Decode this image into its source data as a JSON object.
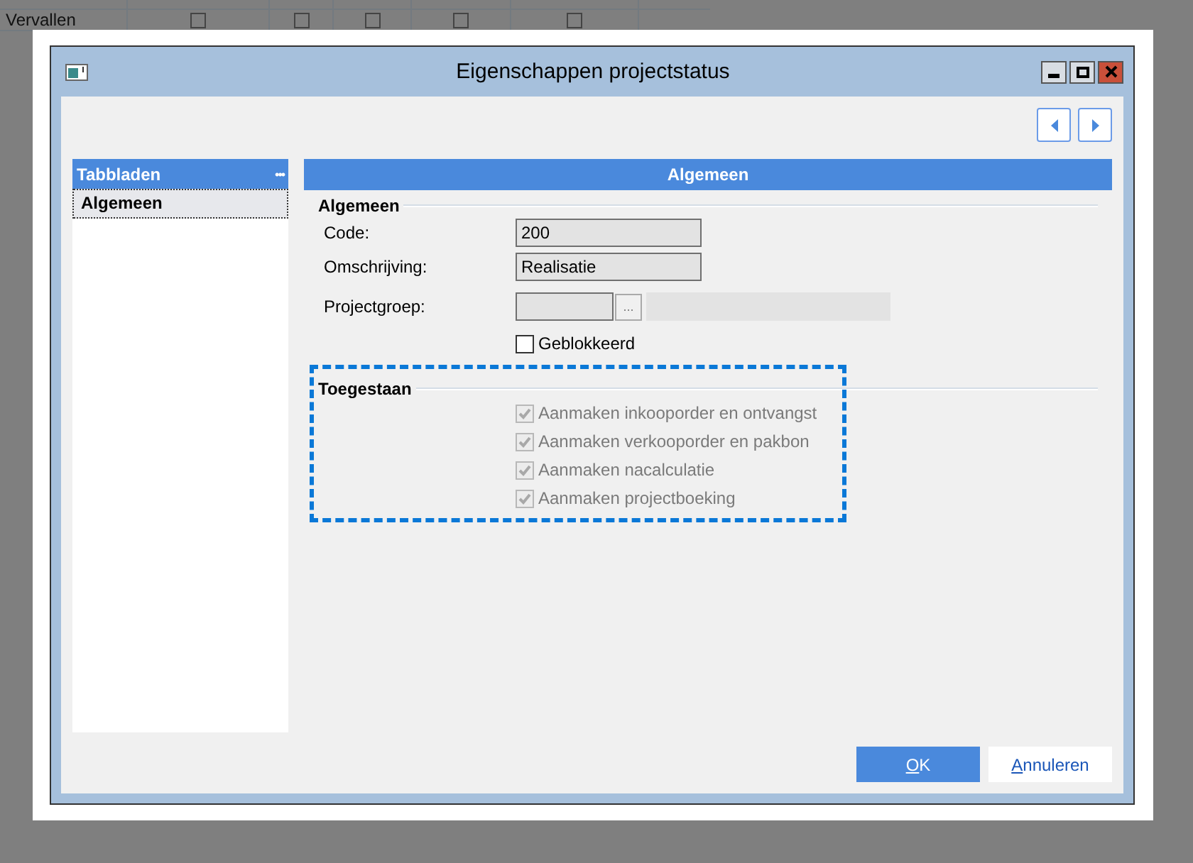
{
  "background_table": {
    "rows": [
      {
        "label": "Vervallen",
        "checks": [
          false,
          false,
          false,
          false,
          false
        ]
      }
    ]
  },
  "window": {
    "title": "Eigenschappen projectstatus"
  },
  "sidebar": {
    "title": "Tabbladen",
    "menu": "•••",
    "items": [
      {
        "label": "Algemeen",
        "selected": true
      }
    ]
  },
  "panel": {
    "title": "Algemeen",
    "general": {
      "legend": "Algemeen",
      "code_label": "Code:",
      "code_value": "200",
      "description_label": "Omschrijving:",
      "description_value": "Realisatie",
      "group_label": "Projectgroep:",
      "browse": "...",
      "blocked": {
        "label": "Geblokkeerd",
        "checked": false
      }
    },
    "allowed": {
      "legend": "Toegestaan",
      "options": [
        {
          "label": "Aanmaken inkooporder en ontvangst",
          "checked": true,
          "disabled": true
        },
        {
          "label": "Aanmaken verkooporder en pakbon",
          "checked": true,
          "disabled": true
        },
        {
          "label": "Aanmaken nacalculatie",
          "checked": true,
          "disabled": true
        },
        {
          "label": "Aanmaken projectboeking",
          "checked": true,
          "disabled": true
        }
      ]
    }
  },
  "buttons": [
    {
      "label": "OK",
      "kind": "primary"
    },
    {
      "label": "Annuleren",
      "kind": "secondary"
    }
  ]
}
